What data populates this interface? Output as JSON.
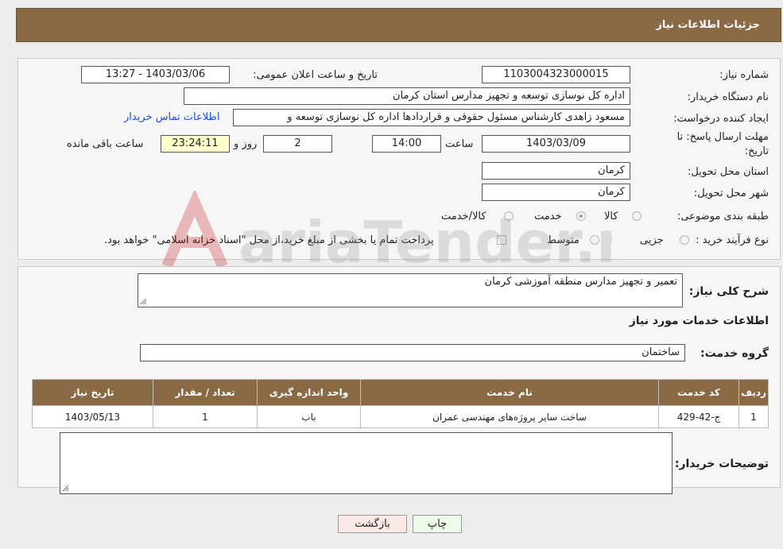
{
  "header": {
    "title": "جزئیات اطلاعات نیاز"
  },
  "form": {
    "need_number_label": "شماره نیاز:",
    "need_number": "1103004323000015",
    "announce_label": "تاریخ و ساعت اعلان عمومی:",
    "announce_value": "1403/03/06 - 13:27",
    "buyer_org_label": "نام دستگاه خریدار:",
    "buyer_org": "اداره کل نوسازی  توسعه و تجهیز مدارس استان کرمان",
    "creator_label": "ایجاد کننده درخواست:",
    "creator": "مسعود زاهدی کارشناس مسئول حقوقی و قراردادها اداره کل نوسازی  توسعه و",
    "contact_link": "اطلاعات تماس خریدار",
    "deadline_label_1": "مهلت ارسال پاسخ: تا",
    "deadline_label_2": "تاریخ:",
    "deadline_date": "1403/03/09",
    "time_label": "ساعت",
    "deadline_time": "14:00",
    "days_value": "2",
    "days_label": "روز و",
    "remaining_time": "23:24:11",
    "remaining_label": "ساعت باقی مانده",
    "province_label": "استان محل تحویل:",
    "province": "کرمان",
    "city_label": "شهر محل تحویل:",
    "city": "کرمان",
    "category_label": "طبقه بندی موضوعی:",
    "category_options": [
      "کالا",
      "خدمت",
      "کالا/خدمت"
    ],
    "process_label": "نوع فرآیند خرید :",
    "process_options": [
      "جزیی",
      "متوسط"
    ],
    "payment_note": "پرداخت تمام یا بخشی از مبلغ خرید،از محل \"اسناد خزانه اسلامی\" خواهد بود."
  },
  "details": {
    "summary_label": "شرح کلی نیاز:",
    "summary": "تعمیر و تجهیز مدارس منطقه آموزشی کرمان",
    "services_heading": "اطلاعات خدمات مورد نیاز",
    "service_group_label": "گروه خدمت:",
    "service_group": "ساختمان",
    "table": {
      "headers": [
        "ردیف",
        "کد خدمت",
        "نام خدمت",
        "واحد اندازه گیری",
        "تعداد / مقدار",
        "تاریخ نیاز"
      ],
      "rows": [
        [
          "1",
          "ج-42-429",
          "ساخت سایر پروژه‌های مهندسی عمران",
          "باب",
          "1",
          "1403/05/13"
        ]
      ]
    },
    "buyer_notes_label": "توضیحات خریدار:",
    "buyer_notes": ""
  },
  "buttons": {
    "print": "چاپ",
    "back": "بازگشت"
  },
  "watermark": {
    "text": "AriaTender.neT",
    "color": "#c00000"
  }
}
